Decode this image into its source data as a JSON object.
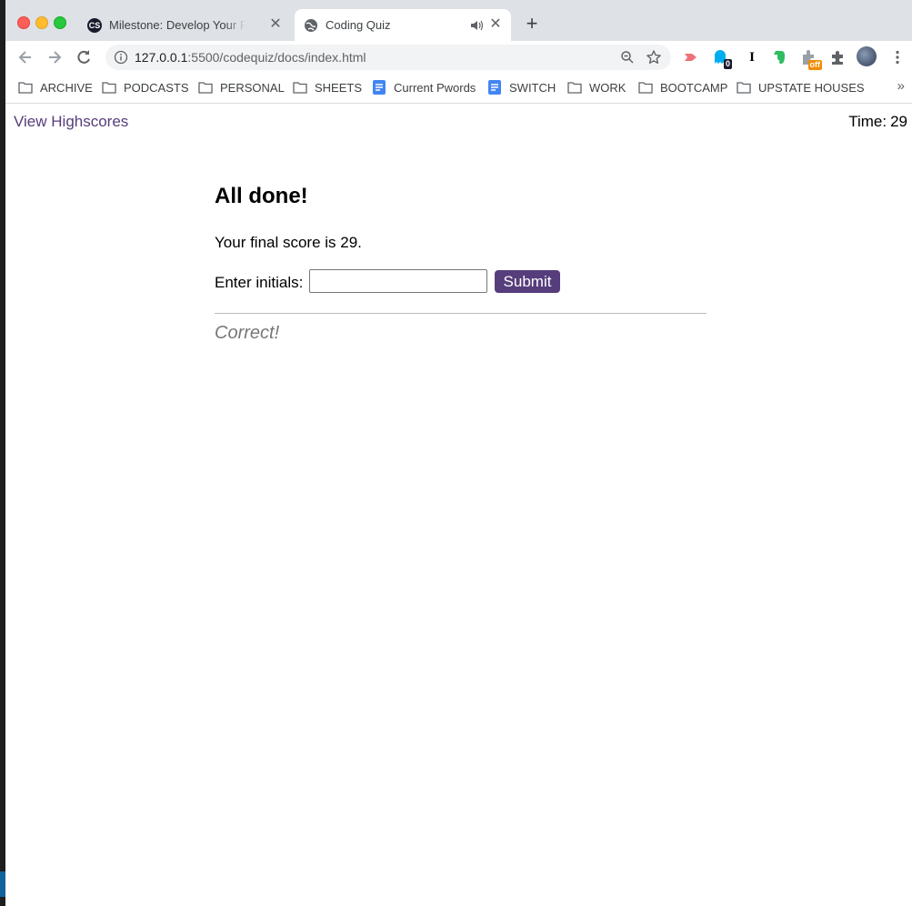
{
  "browser": {
    "tabs": [
      {
        "title": "Milestone: Develop Your Resume"
      },
      {
        "title": "Coding Quiz"
      }
    ],
    "address": {
      "host": "127.0.0.1",
      "rest": ":5500/codequiz/docs/index.html"
    },
    "extensions": [
      {
        "icon": "pocket-like-icon"
      },
      {
        "icon": "ghostery-icon",
        "badge": "0"
      },
      {
        "icon": "instapaper-icon"
      },
      {
        "icon": "evernote-icon"
      },
      {
        "icon": "extension-off-icon",
        "badge": "off"
      },
      {
        "icon": "puzzle-icon"
      },
      {
        "icon": "profile-avatar"
      },
      {
        "icon": "menu-dots-icon"
      }
    ],
    "bookmarks": [
      {
        "label": "ARCHIVE",
        "icon": "folder-icon"
      },
      {
        "label": "PODCASTS",
        "icon": "folder-icon"
      },
      {
        "label": "PERSONAL",
        "icon": "folder-icon"
      },
      {
        "label": "SHEETS",
        "icon": "folder-icon"
      },
      {
        "label": "Current Pwords",
        "icon": "doc-icon"
      },
      {
        "label": "SWITCH",
        "icon": "doc-icon"
      },
      {
        "label": "WORK",
        "icon": "folder-icon"
      },
      {
        "label": "BOOTCAMP",
        "icon": "folder-icon"
      },
      {
        "label": "UPSTATE HOUSES",
        "icon": "folder-icon"
      }
    ],
    "more_bookmarks": "»"
  },
  "page": {
    "highscores_link": "View Highscores",
    "timer_label": "Time:",
    "timer_value": "29",
    "heading": "All done!",
    "score_text": "Your final score is 29.",
    "initials_label": "Enter initials:",
    "initials_value": "",
    "submit_label": "Submit",
    "feedback": "Correct!"
  },
  "colors": {
    "link": "#563d7c",
    "button_bg": "#563d7c",
    "feedback": "#777777"
  }
}
